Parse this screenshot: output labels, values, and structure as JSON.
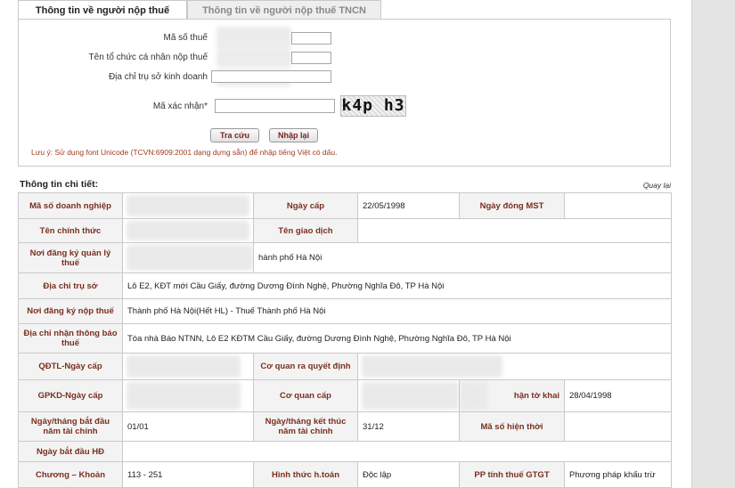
{
  "tabs": [
    {
      "label": "Thông tin về người nộp thuế",
      "active": true
    },
    {
      "label": "Thông tin về người nộp thuế TNCN",
      "active": false
    }
  ],
  "search_form": {
    "tax_code_label": "Mã số thuế",
    "org_name_label": "Tên tổ chức cá nhân nộp thuế",
    "address_label": "Địa chỉ trụ sở kinh doanh",
    "captcha_label": "Mã xác nhận*",
    "captcha_text": "k4p h3",
    "search_button": "Tra cứu",
    "reset_button": "Nhập lại",
    "note": "Lưu ý: Sử dụng font Unicode (TCVN:6909:2001 dạng dựng sẵn) để nhập tiếng Việt có dấu."
  },
  "details": {
    "title": "Thông tin chi tiết:",
    "back_link": "Quay lại",
    "rows": {
      "r1": {
        "l1": "Mã số doanh nghiệp",
        "l2": "Ngày cấp",
        "v2": "22/05/1998",
        "l3": "Ngày đóng MST",
        "v3": ""
      },
      "r2": {
        "l1": "Tên chính thức",
        "l2": "Tên giao dịch",
        "v2": ""
      },
      "r3": {
        "l1": "Nơi đăng ký quản lý thuế",
        "v1": "hành phố Hà Nội"
      },
      "r4": {
        "l1": "Địa chỉ trụ sở",
        "v1": "Lô E2, KĐT mới Cầu Giấy, đường Dương Đình Nghệ, Phường Nghĩa Đô, TP Hà Nội"
      },
      "r5": {
        "l1": "Nơi đăng ký nộp thuế",
        "v1": "Thành phố Hà Nội(Hết HL) - Thuế Thành phố Hà Nội"
      },
      "r6": {
        "l1": "Địa chỉ nhận thông báo thuế",
        "v1": "Tòa nhà Báo NTNN, Lô E2 KĐTM Cầu Giấy, đường Dương Đình Nghệ, Phường Nghĩa Đô, TP Hà Nội"
      },
      "r7": {
        "l1": "QĐTL-Ngày cấp",
        "l2": "Cơ quan ra quyết định"
      },
      "r8": {
        "l1": "GPKD-Ngày cấp",
        "l2": "Cơ quan cấp",
        "l3": "hận tờ khai",
        "v3": "28/04/1998"
      },
      "r9": {
        "l1": "Ngày/tháng bắt đầu năm tài chính",
        "v1": "01/01",
        "l2": "Ngày/tháng kết thúc năm tài chính",
        "v2": "31/12",
        "l3": "Mã số hiện thời",
        "v3": ""
      },
      "r10": {
        "l1": "Ngày bắt đầu HĐ",
        "v1": ""
      },
      "r11": {
        "l1": "Chương – Khoản",
        "v1": "113 - 251",
        "l2": "Hình thức h.toán",
        "v2": "Độc lập",
        "l3": "PP tính thuế GTGT",
        "v3": "Phương pháp khấu trừ"
      }
    }
  },
  "colors": {
    "label_text": "#7a2f1f",
    "note_text": "#a23b1f",
    "border": "#c9c9c9"
  }
}
